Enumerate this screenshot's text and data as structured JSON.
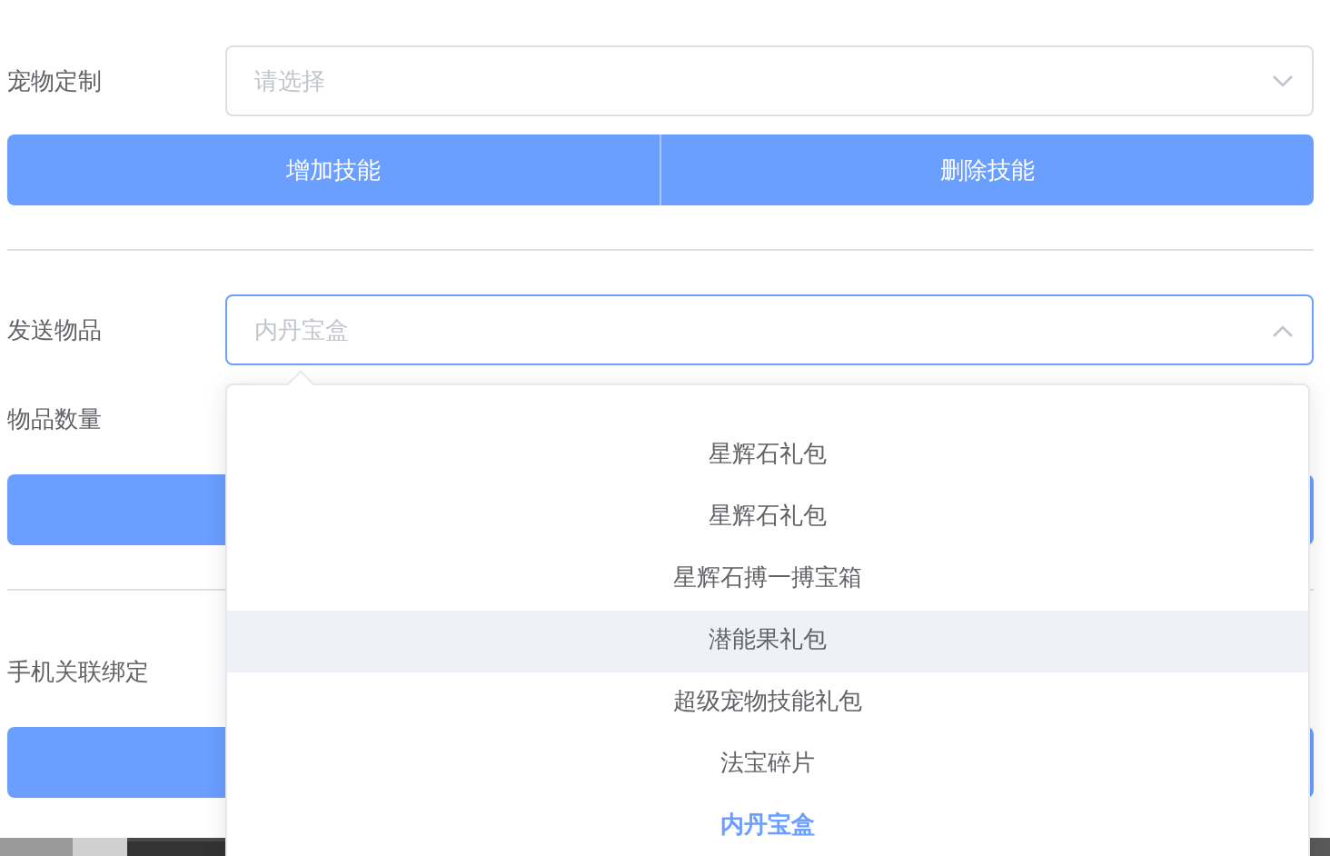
{
  "pet_custom": {
    "label": "宠物定制",
    "placeholder": "请选择"
  },
  "skill_buttons": [
    "增加技能",
    "删除技能"
  ],
  "send_item": {
    "label": "发送物品",
    "placeholder": "内丹宝盒",
    "expanded": true,
    "options": [
      {
        "label": "星辉石礼包",
        "selected": false,
        "hovered": false
      },
      {
        "label": "星辉石礼包",
        "selected": false,
        "hovered": false
      },
      {
        "label": "星辉石搏一搏宝箱",
        "selected": false,
        "hovered": false
      },
      {
        "label": "潜能果礼包",
        "selected": false,
        "hovered": true
      },
      {
        "label": "超级宠物技能礼包",
        "selected": false,
        "hovered": false
      },
      {
        "label": "法宝碎片",
        "selected": false,
        "hovered": false
      },
      {
        "label": "内丹宝盒",
        "selected": true,
        "hovered": false
      }
    ]
  },
  "quantity": {
    "label": "物品数量"
  },
  "phone_bind": {
    "label": "手机关联绑定"
  }
}
